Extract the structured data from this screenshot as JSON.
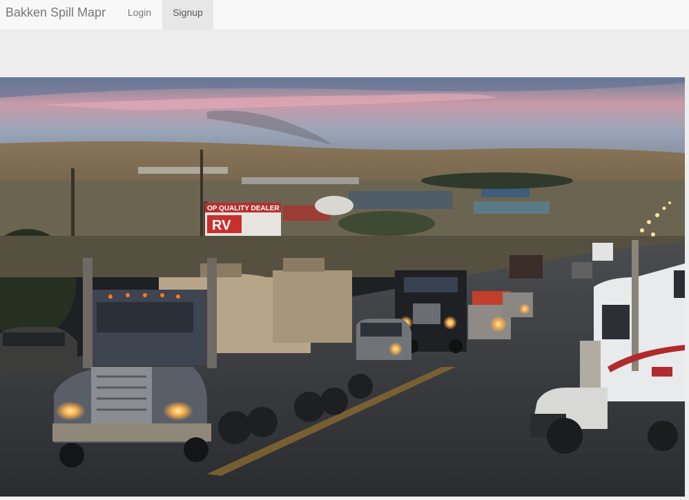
{
  "navbar": {
    "brand": "Bakken Spill Mapr",
    "links": [
      {
        "label": "Login",
        "active": false
      },
      {
        "label": "Signup",
        "active": true
      }
    ]
  },
  "hero": {
    "billboard_line1": "OP QUALITY DEALER",
    "billboard_line2": "RV"
  },
  "colors": {
    "navbar_bg": "#f8f8f8",
    "active_link_bg": "#e7e7e7",
    "page_bg": "#eeeeee"
  }
}
